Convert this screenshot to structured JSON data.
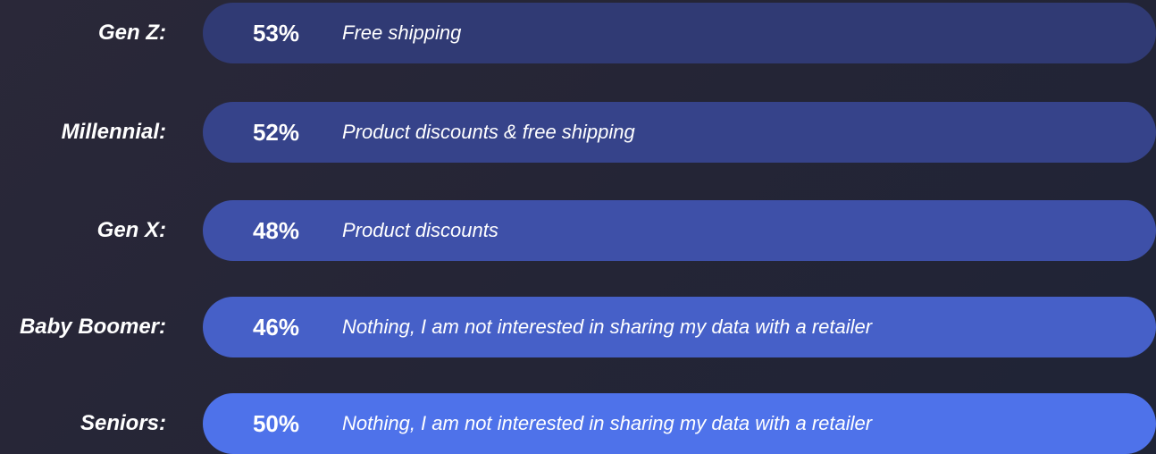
{
  "chart_data": {
    "type": "table",
    "colors": [
      "#303a74",
      "#36438a",
      "#3e50a8",
      "#4660c8",
      "#4e72ea"
    ],
    "rows": [
      {
        "label": "Gen Z:",
        "value": "53%",
        "answer": "Free shipping"
      },
      {
        "label": "Millennial:",
        "value": "52%",
        "answer": "Product discounts & free shipping"
      },
      {
        "label": "Gen X:",
        "value": "48%",
        "answer": "Product discounts"
      },
      {
        "label": "Baby Boomer:",
        "value": "46%",
        "answer": "Nothing, I am not interested in sharing my data with a retailer"
      },
      {
        "label": "Seniors:",
        "value": "50%",
        "answer": "Nothing, I am not interested in sharing my data with a retailer"
      }
    ]
  }
}
